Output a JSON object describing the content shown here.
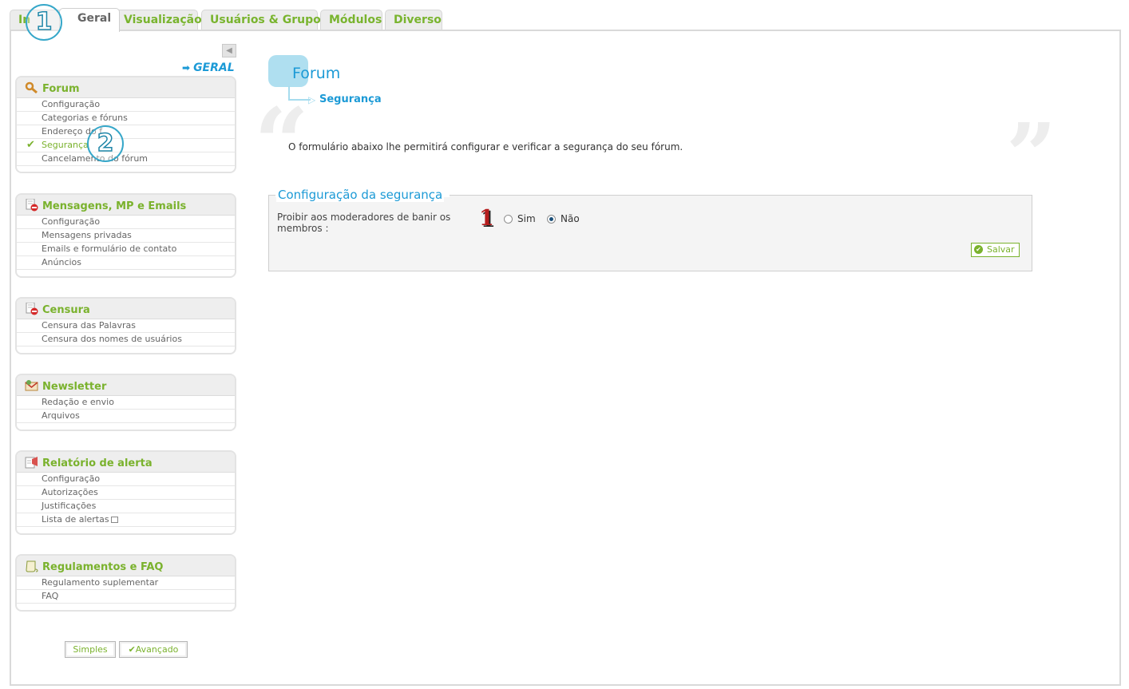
{
  "tabs": [
    {
      "label": "In"
    },
    {
      "label": "Geral"
    },
    {
      "label": "Visualização"
    },
    {
      "label": "Usuários & Grupos"
    },
    {
      "label": "Módulos"
    },
    {
      "label": "Diverso"
    }
  ],
  "annotations": {
    "one": "1",
    "two": "2",
    "field_marker": "1"
  },
  "sidebar": {
    "section_link": "GERAL",
    "menus": [
      {
        "title": "Forum",
        "items": [
          "Configuração",
          "Categorias e fóruns",
          "Endereço do f",
          "Segurança",
          "Cancelamento do fórum"
        ]
      },
      {
        "title": "Mensagens, MP e Emails",
        "items": [
          "Configuração",
          "Mensagens privadas",
          "Emails e formulário de contato",
          "Anúncios"
        ]
      },
      {
        "title": "Censura",
        "items": [
          "Censura das Palavras",
          "Censura dos nomes de usuários"
        ]
      },
      {
        "title": "Newsletter",
        "items": [
          "Redação e envio",
          "Arquivos"
        ]
      },
      {
        "title": "Relatório de alerta",
        "items": [
          "Configuração",
          "Autorizações",
          "Justificações",
          "Lista de alertas"
        ]
      },
      {
        "title": "Regulamentos e FAQ",
        "items": [
          "Regulamento suplementar",
          "FAQ"
        ]
      }
    ],
    "buttons": {
      "simple": "Simples",
      "advanced": "Avançado"
    }
  },
  "main": {
    "title": "Forum",
    "subtitle": "Segurança",
    "description": "O formulário abaixo lhe permitirá configurar e verificar a segurança do seu fórum.",
    "fieldset_legend": "Configuração da segurança",
    "field_label": "Proibir aos moderadores de banir os membros :",
    "options": {
      "yes": "Sim",
      "no": "Não",
      "selected": "Não"
    },
    "save_label": "Salvar"
  },
  "colors": {
    "accent_green": "#7ab22d",
    "accent_blue": "#1c9ad6",
    "annotation_blue": "#36a7c9"
  }
}
